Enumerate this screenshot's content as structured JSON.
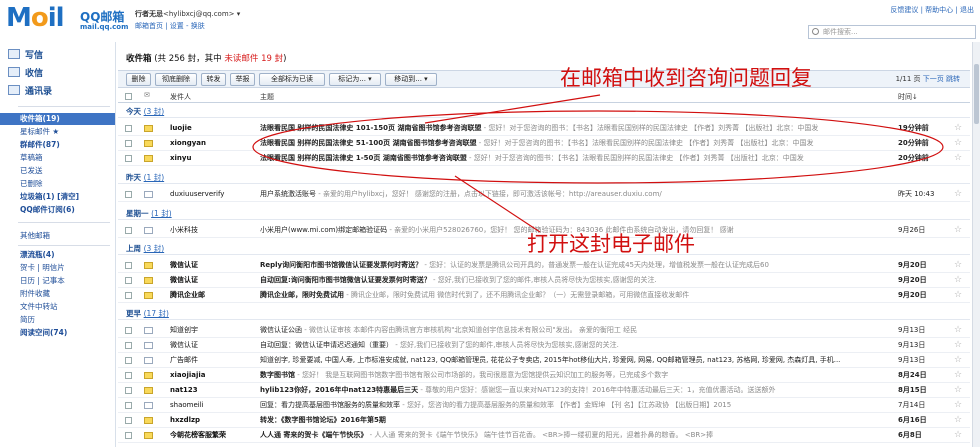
{
  "header": {
    "logo_text_m": "M",
    "logo_text_o": "o",
    "logo_text_il": "il",
    "logo_name": "QQ邮箱",
    "logo_domain": "mail.qq.com",
    "user_name": "行者无忌",
    "user_email": "<hylibxcj@qq.com>",
    "user_links": "邮箱首页 | 设置 - 换肤",
    "top_links": "反馈建议 | 帮助中心 | 退出",
    "search_placeholder": "邮件搜索..."
  },
  "sidebar": {
    "write": "写信",
    "receive": "收信",
    "contacts": "通讯录",
    "folders": [
      {
        "label": "收件箱(19)"
      },
      {
        "label": "星标邮件 ★"
      },
      {
        "label": "群邮件(87)"
      },
      {
        "label": "草稿箱"
      },
      {
        "label": "已发送"
      },
      {
        "label": "已删除"
      },
      {
        "label": "垃圾箱(1)  [清空]"
      },
      {
        "label": "QQ邮件订阅(6)"
      },
      {
        "label": "其他邮箱"
      },
      {
        "label": "漂流瓶(4)"
      },
      {
        "label": "贺卡 | 明信片"
      },
      {
        "label": "日历 | 记事本"
      },
      {
        "label": "附件收藏"
      },
      {
        "label": "文件中转站"
      },
      {
        "label": "简历"
      },
      {
        "label": "阅读空间(74)"
      }
    ]
  },
  "main": {
    "title_prefix": "收件箱",
    "title_total": "(共 256 封，其中 ",
    "title_unread": "未读邮件 19 封",
    "title_suffix": ")",
    "toolbar": [
      "删除",
      "彻底删除",
      "转发",
      "举报",
      "全部标为已读",
      "标记为... ▾",
      "移动到... ▾"
    ],
    "pager_page": "1/11 页",
    "pager_next": "下一页",
    "pager_jump": "跳转",
    "col_from": "发件人",
    "col_subject": "主题",
    "col_time": "时间↓",
    "groups": {
      "today": {
        "label": "今天",
        "count": "(3 封)"
      },
      "yesterday": {
        "label": "昨天",
        "count": "(1 封)"
      },
      "lastweek1": {
        "label": "星期一",
        "count": "(1 封)"
      },
      "lastweek": {
        "label": "上周",
        "count": "(3 封)"
      },
      "earlier": {
        "label": "更早",
        "count": "(17 封)"
      }
    },
    "rows": [
      {
        "from": "luojie",
        "subject": "法眼看民国  别样的民国法律史  101-150页  湖南省图书馆参考咨询联盟",
        "preview": " - 您好！对于您咨询的图书：【书名】法眼看民国别样的民国法律史 【作者】刘秀菁 【出版社】北京：中国发",
        "time": "19分钟前"
      },
      {
        "from": "xiongyan",
        "subject": "法眼看民国  别样的民国法律史  51-100页  湖南省图书馆参考咨询联盟",
        "preview": " - 您好！对于您咨询的图书：【书名】法眼看民国别样的民国法律史 【作者】刘秀菁 【出版社】北京：中国发",
        "time": "20分钟前"
      },
      {
        "from": "xinyu",
        "subject": "法眼看民国  别样的民国法律史  1-50页  湖南省图书馆参考咨询联盟",
        "preview": " - 您好！对于您咨询的图书：【书名】法眼看民国别样的民国法律史 【作者】刘秀菁 【出版社】北京：中国发",
        "time": "20分钟前"
      },
      {
        "from": "duxiuuserverify",
        "subject": "用户系统激活账号",
        "preview": " - 亲爱的用户hylibxcj，您好！ 感谢您的注册，点击以下链接，即可激活该帐号：http://areauser.duxiu.com/",
        "time": "昨天 10:43"
      },
      {
        "from": "小米科技",
        "subject": "小米用户(www.mi.com)绑定邮箱验证码",
        "preview": " - 亲爱的小米用户528026760，您好！ 您的邮箱验证码为：843036 此邮件由系统自动发出，请勿回复！ 感谢",
        "time": "9月26日"
      },
      {
        "from": "微信认证",
        "subject": "Reply询问衡阳市图书馆微信认证要发票何时寄送？",
        "preview": " - 您好：认证的发票是腾讯公司开具的，普通发票一般在认证完成45天内处理，增值税发票一般在认证完成后60",
        "time": "9月20日"
      },
      {
        "from": "微信认证",
        "subject": "自动回复:询问衡阳市图书馆微信认证要发票何时寄送？",
        "preview": " - 您好,我们已接收到了您的邮件,审核人员将尽快为您核实,感谢您的关注.",
        "time": "9月20日"
      },
      {
        "from": "腾讯企业邮",
        "subject": "腾讯企业邮，限时免费试用",
        "preview": " - 腾讯企业邮，限时免费试用 微信时代到了，还不用腾讯企业邮？（一）无需登录邮箱，可用微信直接收发邮件",
        "time": "9月20日"
      },
      {
        "from": "知道创宇",
        "subject": "微信认证公函",
        "preview": " - 微信认证审核 本邮件内容由腾讯官方审核机构\"北京知道创宇信息技术有限公司\"发出。 亲爱的衡阳工 经民",
        "time": "9月13日"
      },
      {
        "from": "微信认证",
        "subject": "自动回复：微信认证申请迟迟通知（重要）",
        "preview": " - 您好,我们已接收到了您的邮件,审核人员将尽快为您核实,感谢您的关注.",
        "time": "9月13日"
      },
      {
        "from": "广告邮件",
        "subject": "知道创字, 珍爱要减, 中国人寿, 上市标准安成就, nat123, QQ邮箱管理员, 花花公子专卖店, 2015年hot移仙大片, 珍爱网, 网易, QQ邮箱管理员, nat123, 苏格网, 珍爱网, 杰森灯具, 手机...",
        "preview": "",
        "time": "9月13日"
      },
      {
        "from": "xiaojiajia",
        "subject": "数字图书馆",
        "preview": " - 您好！ 我是互联网图书馆数字图书馆有限公司市场部的，我司很愿意为您馆提供云知识加工的服务等，已完成多个数字",
        "time": "8月24日"
      },
      {
        "from": "nat123",
        "subject": "hylib123你好，2016年中nat123特惠最后三天",
        "preview": " - 尊敬的用户您好：感谢您一直以来对NAT123的支持！2016年中特惠活动最后三天：1，充值优惠活动。送送额外",
        "time": "8月15日"
      },
      {
        "from": "shaomeili",
        "subject": "回复：看力提高基层图书馆服务的质量和效率",
        "preview": " - 您好，您咨询的看力提高基层服务的质量和效率 【作者】金辉坤 【刊 名】【江苏政协 【出版日期】2015",
        "time": "7月14日"
      },
      {
        "from": "hxzdlzp",
        "subject": "转发：《数字图书馆论坛》2016年第5期",
        "preview": "",
        "time": "6月16日"
      },
      {
        "from": "今朝花榜客服繁荣",
        "subject": "人人通 寄来的贺卡《端午节快乐》",
        "preview": " - 人人通 寄来的贺卡《端午节快乐》 端午佳节百花香。 <BR>捧一缕初夏的阳光，迎着扑鼻的粽香。 <BR>捧",
        "time": "6月8日"
      }
    ]
  },
  "annotations": {
    "a1": "在邮箱中收到咨询问题回复",
    "a2": "打开这封电子邮件",
    "color": "#d10f0f"
  }
}
